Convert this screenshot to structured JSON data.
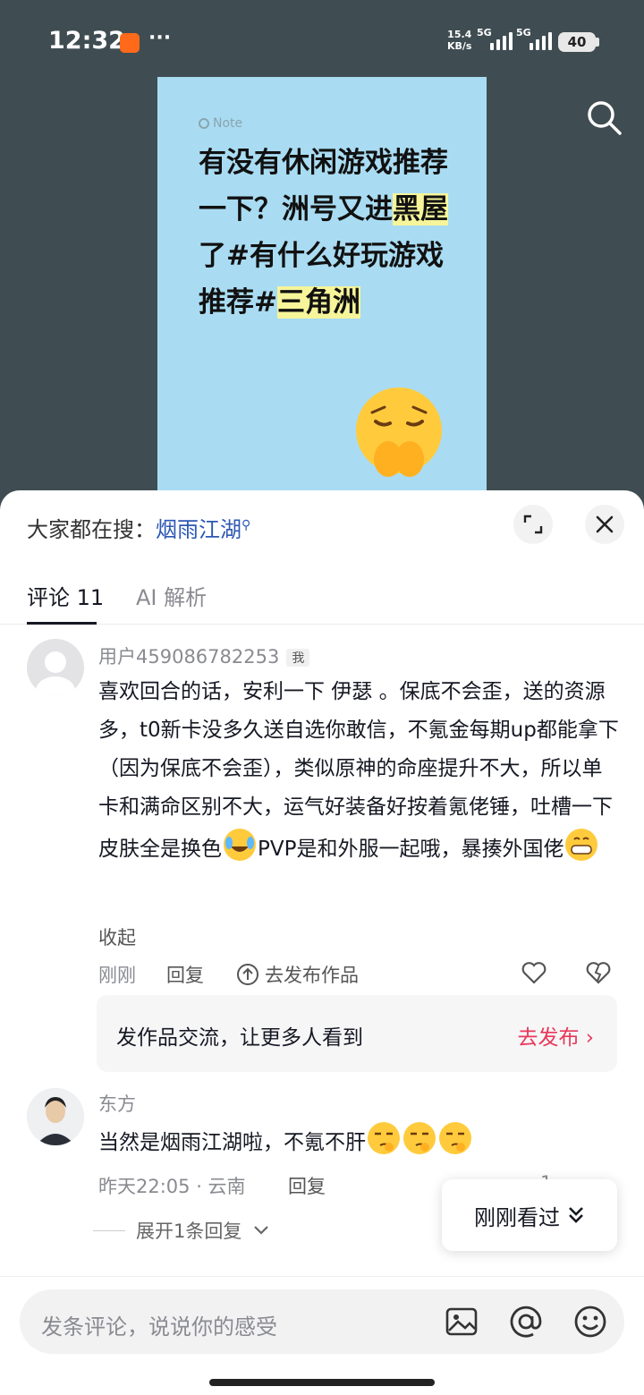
{
  "status_bar": {
    "time": "12:32",
    "dots": "···",
    "net_speed_value": "15.4",
    "net_speed_unit": "KB/s",
    "signal1_label": "5G",
    "signal2_label": "5G",
    "battery": "40"
  },
  "note": {
    "label": "Note",
    "title_part1": "有没有休闲游戏推荐一下？洲号又进",
    "title_hl1": "黑屋",
    "title_part2": "了#有什么好玩游戏推荐#",
    "title_hl2": "三角洲"
  },
  "sheet": {
    "hot_search_prefix": "大家都在搜：",
    "hot_search_keyword": "烟雨江湖",
    "tabs": [
      {
        "label": "评论 11",
        "active": true
      },
      {
        "label": "AI 解析",
        "active": false
      }
    ]
  },
  "comments": [
    {
      "username": "用户459086782253",
      "badge": "我",
      "text_part1": "喜欢回合的话，安利一下 伊瑟 。保底不会歪，送的资源多，t0新卡没多久送自选你敢信，不氪金每期up都能拿下（因为保底不会歪），类似原神的命座提升不大，所以单卡和满命区别不大，运气好装备好按着氪佬锤，吐槽一下皮肤全是换色",
      "text_part2": "PVP是和外服一起哦，暴揍外国佬",
      "collapse": "收起",
      "time": "刚刚",
      "reply": "回复",
      "publish_link": "去发布作品"
    },
    {
      "username": "东方",
      "text": "当然是烟雨江湖啦，不氪不肝",
      "time": "昨天22:05 · 云南",
      "reply": "回复",
      "like_count": "1",
      "expand": "展开1条回复"
    }
  ],
  "publish_box": {
    "text": "发作品交流，让更多人看到",
    "action": "去发布 ›"
  },
  "float_button": {
    "label": "刚刚看过"
  },
  "input": {
    "placeholder": "发条评论，说说你的感受"
  },
  "colors": {
    "link_blue": "#2c58b4",
    "accent_red": "#e8385a",
    "note_bg": "#a9dcf2",
    "top_bg": "#3f4d52"
  }
}
